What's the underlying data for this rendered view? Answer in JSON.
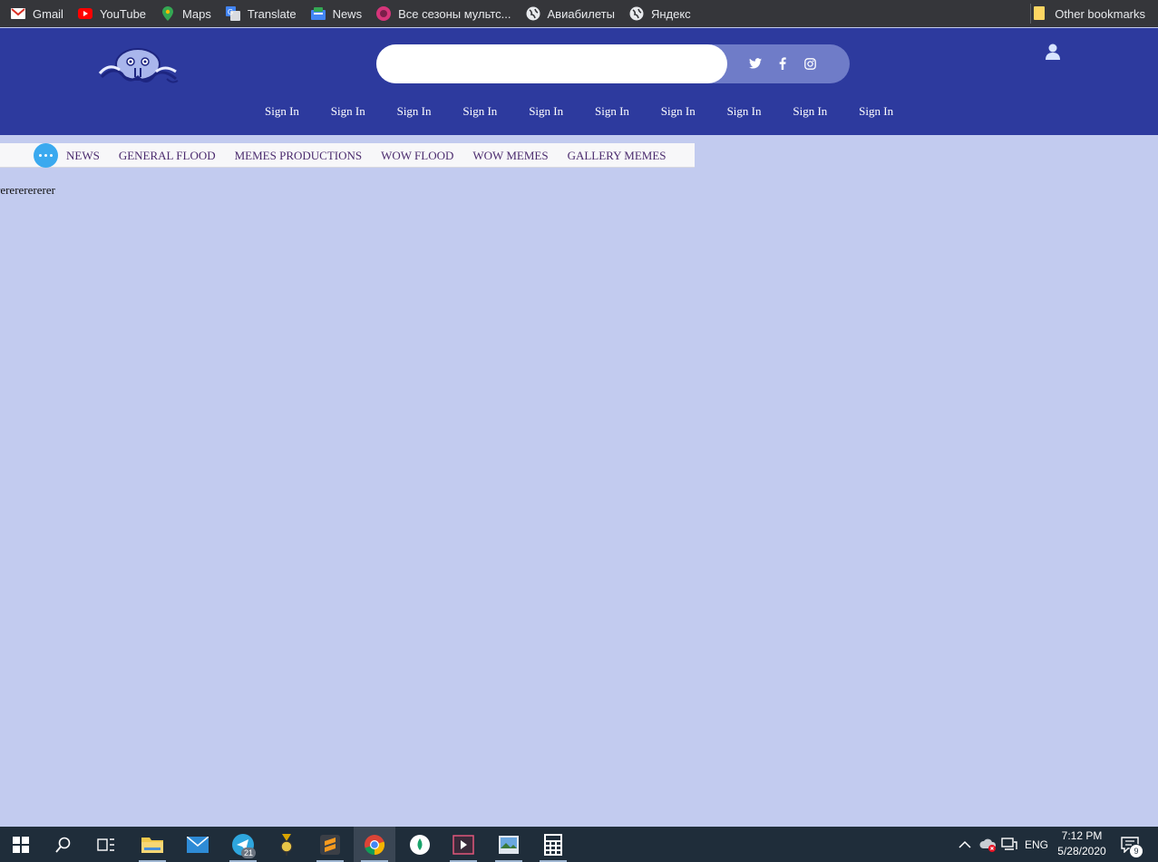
{
  "bookmarks": [
    {
      "label": "Gmail",
      "icon": "gmail-icon"
    },
    {
      "label": "YouTube",
      "icon": "youtube-icon"
    },
    {
      "label": "Maps",
      "icon": "maps-icon"
    },
    {
      "label": "Translate",
      "icon": "translate-icon"
    },
    {
      "label": "News",
      "icon": "news-icon"
    },
    {
      "label": "Все сезоны мультс...",
      "icon": "cartoon-icon"
    },
    {
      "label": "Авиабилеты",
      "icon": "globe-icon"
    },
    {
      "label": "Яндекс",
      "icon": "globe-icon"
    }
  ],
  "other_bookmarks": "Other bookmarks",
  "header": {
    "search_value": "",
    "social": [
      "twitter-icon",
      "facebook-icon",
      "instagram-icon"
    ],
    "nav": [
      "Sign In",
      "Sign In",
      "Sign In",
      "Sign In",
      "Sign In",
      "Sign In",
      "Sign In",
      "Sign In",
      "Sign In",
      "Sign In"
    ]
  },
  "categories": [
    "NEWS",
    "GENERAL FLOOD",
    "MEMES PRODUCTIONS",
    "WOW FLOOD",
    "WOW MEMES",
    "GALLERY MEMES"
  ],
  "body_text": "rerererererer",
  "taskbar": {
    "language": "ENG",
    "time": "7:12 PM",
    "date": "5/28/2020",
    "telegram_badge": "21",
    "notification_count": "9"
  },
  "colors": {
    "header_bg": "#2d3a9e",
    "page_bg": "#c2cbef",
    "accent": "#3aa9ef"
  }
}
